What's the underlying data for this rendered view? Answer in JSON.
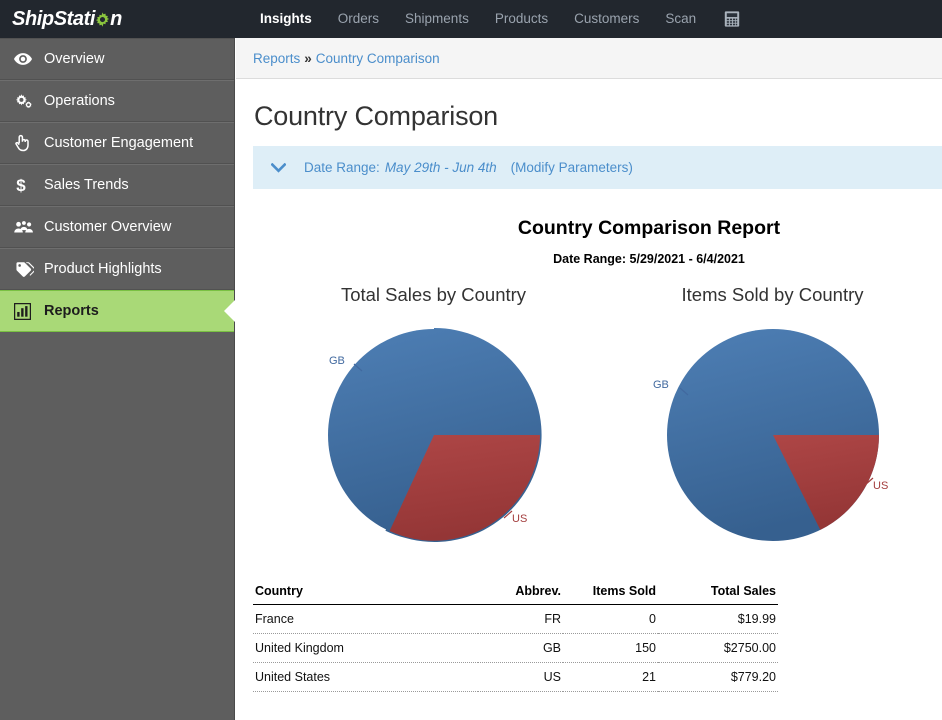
{
  "brand": {
    "name_part1": "ShipStati",
    "name_part2": "n",
    "logo_icon": "gear-icon",
    "topbar_bg": "#22272e",
    "accent_green": "#7ac143"
  },
  "topnav": {
    "items": [
      {
        "label": "Insights",
        "active": true
      },
      {
        "label": "Orders",
        "active": false
      },
      {
        "label": "Shipments",
        "active": false
      },
      {
        "label": "Products",
        "active": false
      },
      {
        "label": "Customers",
        "active": false
      },
      {
        "label": "Scan",
        "active": false
      }
    ],
    "trailing_icon": "calculator-icon"
  },
  "sidebar": {
    "items": [
      {
        "label": "Overview",
        "icon": "eye-icon",
        "active": false
      },
      {
        "label": "Operations",
        "icon": "gears-icon",
        "active": false
      },
      {
        "label": "Customer Engagement",
        "icon": "hand-pointer-icon",
        "active": false
      },
      {
        "label": "Sales Trends",
        "icon": "dollar-icon",
        "active": false
      },
      {
        "label": "Customer Overview",
        "icon": "users-icon",
        "active": false
      },
      {
        "label": "Product Highlights",
        "icon": "tags-icon",
        "active": false
      },
      {
        "label": "Reports",
        "icon": "bar-chart-icon",
        "active": true
      }
    ],
    "bg": "#5e5e5e",
    "active_bg": "#a9d977"
  },
  "breadcrumb": {
    "parent": "Reports",
    "separator": "»",
    "current": "Country Comparison"
  },
  "page": {
    "title": "Country Comparison"
  },
  "date_range_bar": {
    "chevron_icon": "chevron-down-icon",
    "label": "Date Range:",
    "value": "May 29th - Jun 4th",
    "modify_link": "(Modify Parameters)",
    "bg": "#deeef7",
    "text_color": "#4b8ecb"
  },
  "report": {
    "title": "Country Comparison Report",
    "subtitle": "Date Range: 5/29/2021 - 6/4/2021"
  },
  "chart_data": [
    {
      "type": "pie",
      "title": "Total Sales by Country",
      "categories": [
        "GB",
        "US"
      ],
      "values": [
        2750.0,
        779.2
      ],
      "percents": [
        77.9,
        22.1
      ],
      "colors": [
        "#41699f",
        "#a33d3d"
      ],
      "labels": [
        {
          "text": "GB",
          "color": "#41699f"
        },
        {
          "text": "US",
          "color": "#a33d3d"
        }
      ],
      "legend": "none",
      "grid": false
    },
    {
      "type": "pie",
      "title": "Items Sold by Country",
      "categories": [
        "GB",
        "US"
      ],
      "values": [
        150,
        21
      ],
      "percents": [
        87.7,
        12.3
      ],
      "colors": [
        "#41699f",
        "#a33d3d"
      ],
      "labels": [
        {
          "text": "GB",
          "color": "#41699f"
        },
        {
          "text": "US",
          "color": "#a33d3d"
        }
      ],
      "legend": "none",
      "grid": false
    }
  ],
  "table": {
    "headers": [
      "Country",
      "Abbrev.",
      "Items Sold",
      "Total Sales"
    ],
    "rows": [
      {
        "country": "France",
        "abbrev": "FR",
        "items_sold": "0",
        "total_sales": "$19.99"
      },
      {
        "country": "United Kingdom",
        "abbrev": "GB",
        "items_sold": "150",
        "total_sales": "$2750.00"
      },
      {
        "country": "United States",
        "abbrev": "US",
        "items_sold": "21",
        "total_sales": "$779.20"
      }
    ]
  }
}
